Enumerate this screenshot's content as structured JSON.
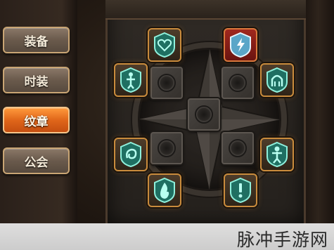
{
  "menu": {
    "items": [
      {
        "label": "装备",
        "active": false
      },
      {
        "label": "时装",
        "active": false
      },
      {
        "label": "纹章",
        "active": true
      },
      {
        "label": "公会",
        "active": false
      }
    ]
  },
  "slots": [
    {
      "icon": "heart-emblem-icon",
      "color": "teal"
    },
    {
      "icon": "bolt-emblem-icon",
      "color": "red-active"
    },
    {
      "icon": "figure-emblem-icon",
      "color": "teal"
    },
    {
      "icon": "arch-emblem-icon",
      "color": "teal"
    },
    {
      "icon": "swirl-emblem-icon",
      "color": "teal"
    },
    {
      "icon": "person-emblem-icon",
      "color": "teal"
    },
    {
      "icon": "fire-emblem-icon",
      "color": "teal"
    },
    {
      "icon": "exclaim-emblem-icon",
      "color": "teal"
    }
  ],
  "watermark": {
    "text": "脉冲手游网"
  },
  "colors": {
    "accent_active": "#e0661a",
    "emblem_teal": "#3fd4b8",
    "slot_border": "#c98b3c"
  }
}
